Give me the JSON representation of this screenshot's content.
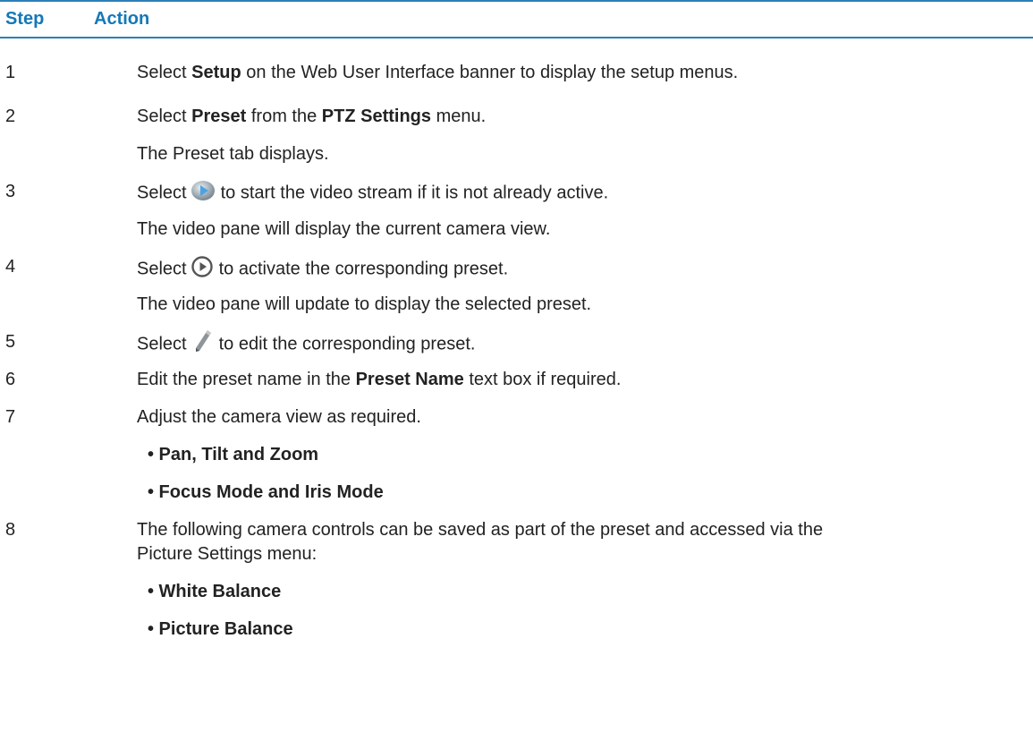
{
  "table": {
    "header": {
      "step": "Step",
      "action": "Action"
    },
    "rows": [
      {
        "num": "1",
        "parts": [
          "Select ",
          "Setup",
          " on the Web User Interface banner to display the setup menus."
        ]
      },
      {
        "num": "2",
        "parts": [
          "Select ",
          "Preset",
          " from the ",
          "PTZ Settings",
          " menu."
        ],
        "result": "The Preset tab displays."
      },
      {
        "num": "3",
        "before": "Select",
        "icon": "play-stream-icon",
        "after": "to start the video stream if it is not already active.",
        "result": "The video pane will display the current camera view."
      },
      {
        "num": "4",
        "before": "Select",
        "icon": "activate-preset-icon",
        "after": "to activate the corresponding preset.",
        "result": "The video pane will update to display the selected preset."
      },
      {
        "num": "5",
        "before": "Select",
        "icon": "edit-pencil-icon",
        "after": "to edit the corresponding preset."
      },
      {
        "num": "6",
        "parts": [
          "Edit the preset name in the ",
          "Preset Name",
          " text box if required."
        ]
      },
      {
        "num": "7",
        "text": "Adjust the camera view as required.",
        "bullets": [
          "• Pan, Tilt and Zoom",
          "• Focus Mode and Iris Mode"
        ]
      },
      {
        "num": "8",
        "lines": [
          "The following camera controls can be saved as part of the preset and accessed via the",
          "Picture Settings menu:"
        ],
        "bullets": [
          "• White Balance",
          "• Picture Balance"
        ]
      }
    ]
  }
}
